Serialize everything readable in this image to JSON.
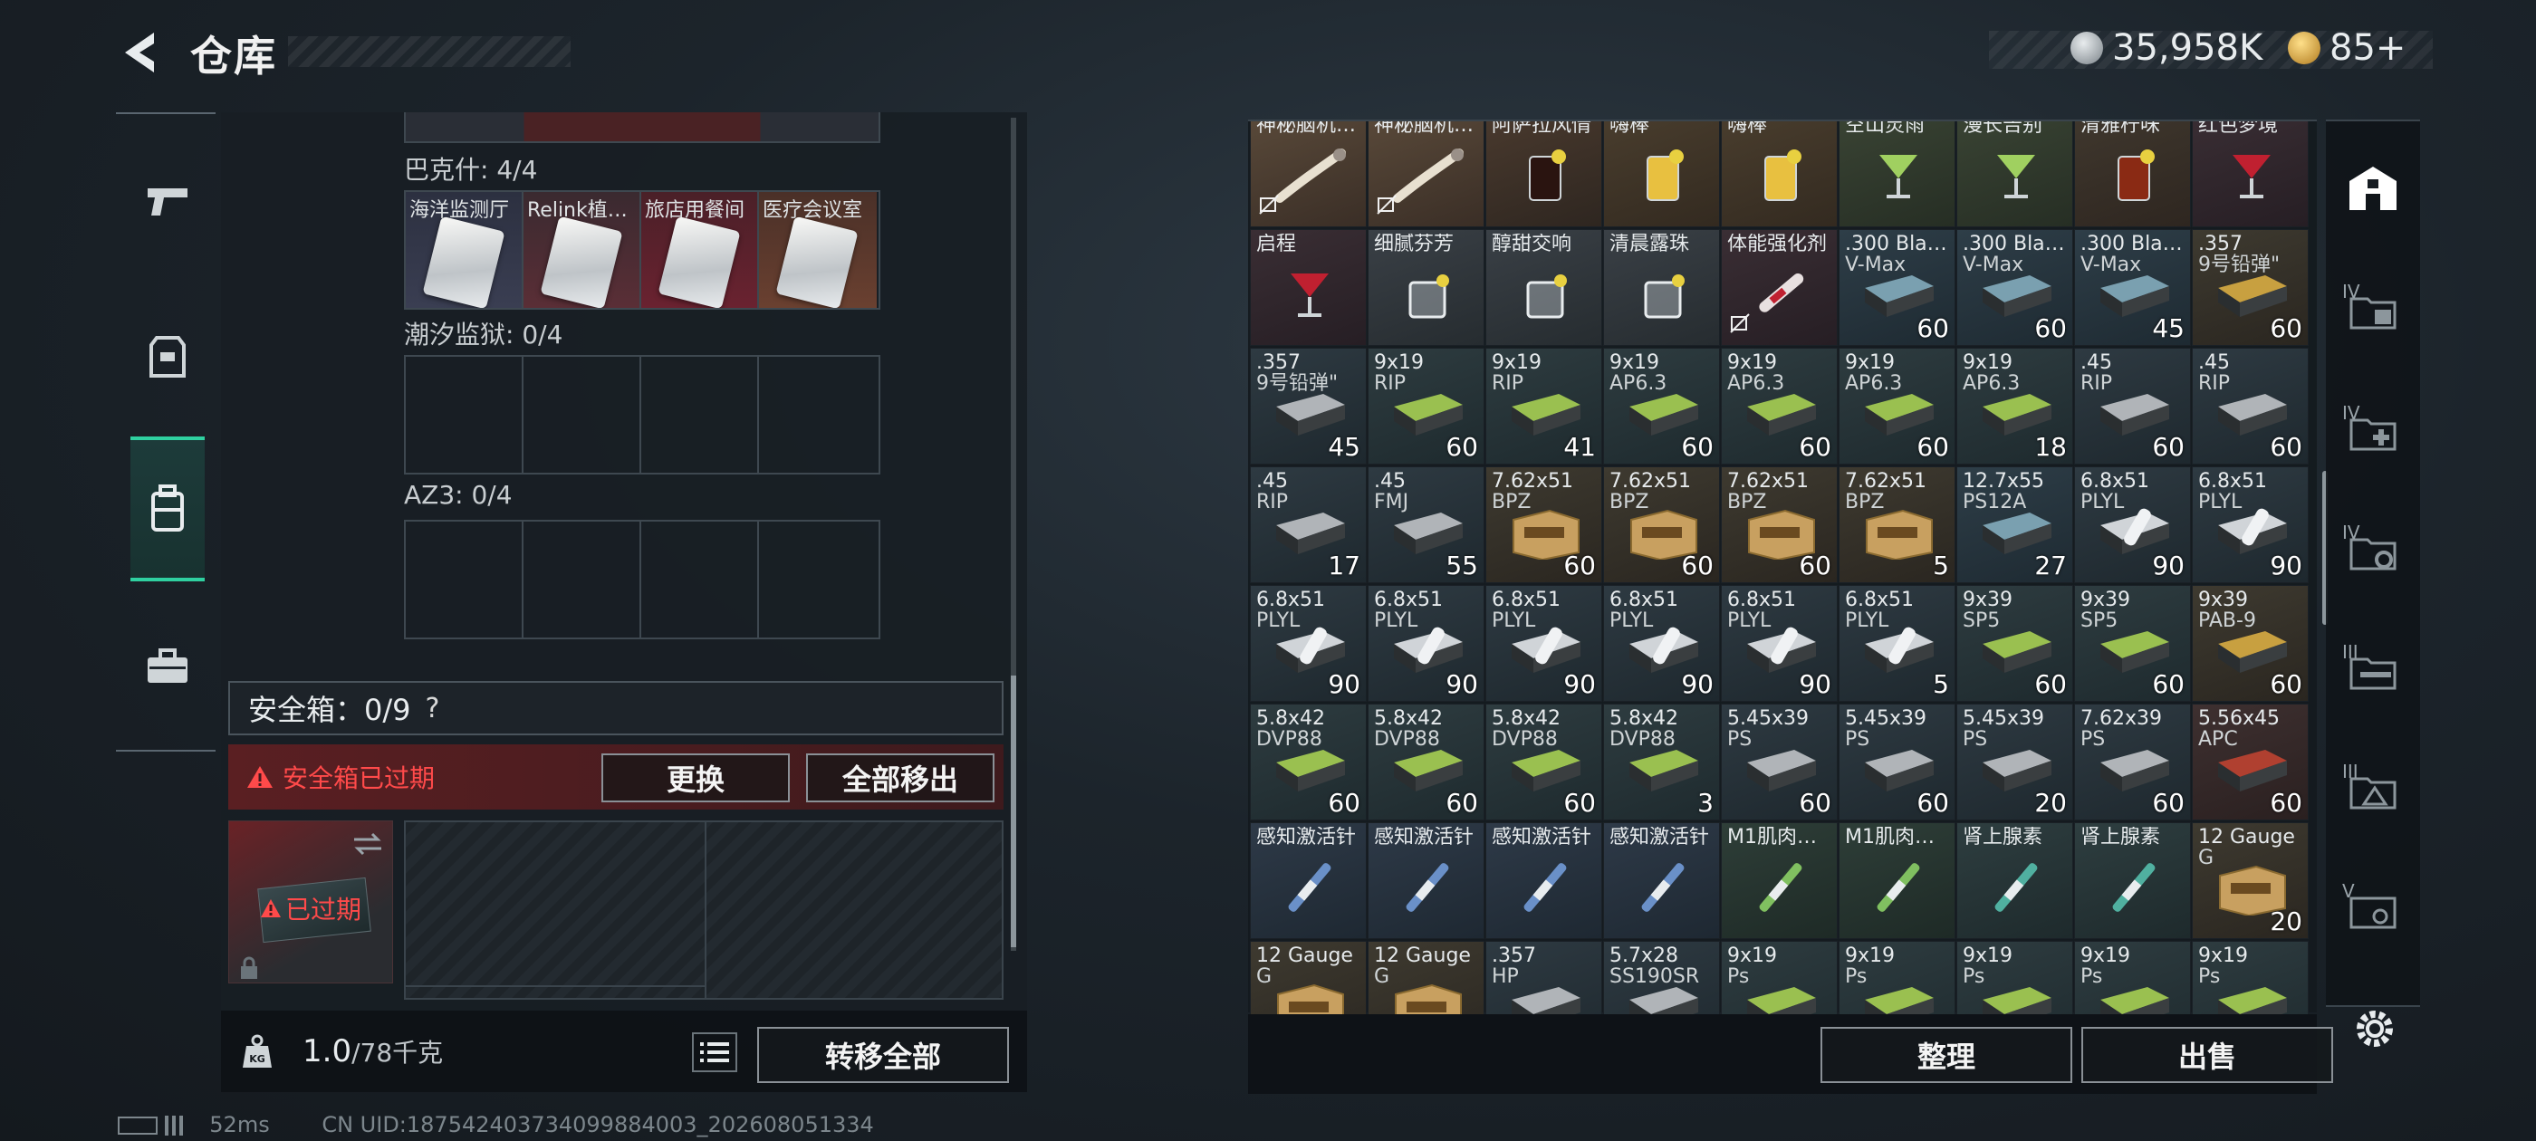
{
  "header": {
    "title": "仓库",
    "currency_silver": "35,958K",
    "currency_gold": "85+"
  },
  "left_nav": {
    "items": [
      {
        "name": "weapon",
        "icon": "pistol-icon"
      },
      {
        "name": "armor",
        "icon": "vest-icon"
      },
      {
        "name": "backpack",
        "icon": "backpack-icon",
        "active": true
      },
      {
        "name": "case",
        "icon": "briefcase-icon"
      }
    ]
  },
  "keycards": {
    "sections": [
      {
        "label": "巴克什: 4/4",
        "slots": [
          "海洋监测厅",
          "Relink植…",
          "旅店用餐间",
          "医疗会议室"
        ]
      },
      {
        "label": "潮汐监狱: 0/4",
        "slots": [
          "",
          "",
          "",
          ""
        ]
      },
      {
        "label": "AZ3: 0/4",
        "slots": [
          "",
          "",
          "",
          ""
        ]
      }
    ]
  },
  "safebox": {
    "label": "安全箱：0/9",
    "help": "?",
    "expired_label": "安全箱已过期",
    "replace_button": "更换",
    "move_all_button": "全部移出",
    "case_status": "已过期"
  },
  "bottom": {
    "weight_value": "1.0",
    "weight_unit": "/78千克",
    "transfer_all_button": "转移全部"
  },
  "status": {
    "ping": "52ms",
    "uid": "CN UID:187542403734099884003_202608051334"
  },
  "stash": {
    "sort_button": "整理",
    "sell_button": "出售",
    "rows": [
      [
        {
          "n1": "神秘脑机…",
          "n2": "",
          "c": "",
          "kind": "serum",
          "nodrop": true
        },
        {
          "n1": "神秘脑机…",
          "n2": "",
          "c": "",
          "kind": "serum",
          "nodrop": true
        },
        {
          "n1": "阿萨拉风情",
          "n2": "",
          "c": "",
          "kind": "drink-dark"
        },
        {
          "n1": "嗨棒",
          "n2": "",
          "c": "",
          "kind": "drink-yellow"
        },
        {
          "n1": "嗨棒",
          "n2": "",
          "c": "",
          "kind": "drink-yellow"
        },
        {
          "n1": "空山灵雨",
          "n2": "",
          "c": "",
          "kind": "drink-green"
        },
        {
          "n1": "漫长告别",
          "n2": "",
          "c": "",
          "kind": "drink-green"
        },
        {
          "n1": "清雅柠味",
          "n2": "",
          "c": "",
          "kind": "drink-tea"
        },
        {
          "n1": "红色梦境",
          "n2": "",
          "c": "",
          "kind": "drink-red"
        }
      ],
      [
        {
          "n1": "启程",
          "n2": "",
          "c": "",
          "kind": "drink-red"
        },
        {
          "n1": "细腻芬芳",
          "n2": "",
          "c": "",
          "kind": "glass"
        },
        {
          "n1": "醇甜交响",
          "n2": "",
          "c": "",
          "kind": "glass"
        },
        {
          "n1": "清晨露珠",
          "n2": "",
          "c": "",
          "kind": "glass"
        },
        {
          "n1": "体能强化剂",
          "n2": "",
          "c": "",
          "kind": "injector-red",
          "nodrop": true
        },
        {
          "n1": ".300 Bla…",
          "n2": "V-Max",
          "c": "60",
          "kind": "ammo-blue"
        },
        {
          "n1": ".300 Bla…",
          "n2": "V-Max",
          "c": "60",
          "kind": "ammo-blue"
        },
        {
          "n1": ".300 Bla…",
          "n2": "V-Max",
          "c": "45",
          "kind": "ammo-blue"
        },
        {
          "n1": ".357",
          "n2": "9号铅弹\"",
          "c": "60",
          "kind": "ammo-gold"
        }
      ],
      [
        {
          "n1": ".357",
          "n2": "9号铅弹\"",
          "c": "45",
          "kind": "ammo-grey"
        },
        {
          "n1": "9x19",
          "n2": "RIP",
          "c": "60",
          "kind": "ammo-green"
        },
        {
          "n1": "9x19",
          "n2": "RIP",
          "c": "41",
          "kind": "ammo-green"
        },
        {
          "n1": "9x19",
          "n2": "AP6.3",
          "c": "60",
          "kind": "ammo-green"
        },
        {
          "n1": "9x19",
          "n2": "AP6.3",
          "c": "60",
          "kind": "ammo-green"
        },
        {
          "n1": "9x19",
          "n2": "AP6.3",
          "c": "60",
          "kind": "ammo-green"
        },
        {
          "n1": "9x19",
          "n2": "AP6.3",
          "c": "18",
          "kind": "ammo-green"
        },
        {
          "n1": ".45",
          "n2": "RIP",
          "c": "60",
          "kind": "ammo-grey"
        },
        {
          "n1": ".45",
          "n2": "RIP",
          "c": "60",
          "kind": "ammo-grey"
        }
      ],
      [
        {
          "n1": ".45",
          "n2": "RIP",
          "c": "17",
          "kind": "ammo-grey"
        },
        {
          "n1": ".45",
          "n2": "FMJ",
          "c": "55",
          "kind": "ammo-grey"
        },
        {
          "n1": "7.62x51",
          "n2": "BPZ",
          "c": "60",
          "kind": "ammo-box"
        },
        {
          "n1": "7.62x51",
          "n2": "BPZ",
          "c": "60",
          "kind": "ammo-box"
        },
        {
          "n1": "7.62x51",
          "n2": "BPZ",
          "c": "60",
          "kind": "ammo-box"
        },
        {
          "n1": "7.62x51",
          "n2": "BPZ",
          "c": "5",
          "kind": "ammo-box"
        },
        {
          "n1": "12.7x55",
          "n2": "PS12A",
          "c": "27",
          "kind": "ammo-blue"
        },
        {
          "n1": "6.8x51",
          "n2": "PLYL",
          "c": "90",
          "kind": "ammo-white"
        },
        {
          "n1": "6.8x51",
          "n2": "PLYL",
          "c": "90",
          "kind": "ammo-white"
        }
      ],
      [
        {
          "n1": "6.8x51",
          "n2": "PLYL",
          "c": "90",
          "kind": "ammo-white"
        },
        {
          "n1": "6.8x51",
          "n2": "PLYL",
          "c": "90",
          "kind": "ammo-white"
        },
        {
          "n1": "6.8x51",
          "n2": "PLYL",
          "c": "90",
          "kind": "ammo-white"
        },
        {
          "n1": "6.8x51",
          "n2": "PLYL",
          "c": "90",
          "kind": "ammo-white"
        },
        {
          "n1": "6.8x51",
          "n2": "PLYL",
          "c": "90",
          "kind": "ammo-white"
        },
        {
          "n1": "6.8x51",
          "n2": "PLYL",
          "c": "5",
          "kind": "ammo-white"
        },
        {
          "n1": "9x39",
          "n2": "SP5",
          "c": "60",
          "kind": "ammo-green"
        },
        {
          "n1": "9x39",
          "n2": "SP5",
          "c": "60",
          "kind": "ammo-green"
        },
        {
          "n1": "9x39",
          "n2": "PAB-9",
          "c": "60",
          "kind": "ammo-gold"
        }
      ],
      [
        {
          "n1": "5.8x42",
          "n2": "DVP88",
          "c": "60",
          "kind": "ammo-green"
        },
        {
          "n1": "5.8x42",
          "n2": "DVP88",
          "c": "60",
          "kind": "ammo-green"
        },
        {
          "n1": "5.8x42",
          "n2": "DVP88",
          "c": "60",
          "kind": "ammo-green"
        },
        {
          "n1": "5.8x42",
          "n2": "DVP88",
          "c": "3",
          "kind": "ammo-green"
        },
        {
          "n1": "5.45x39",
          "n2": "PS",
          "c": "60",
          "kind": "ammo-grey"
        },
        {
          "n1": "5.45x39",
          "n2": "PS",
          "c": "60",
          "kind": "ammo-grey"
        },
        {
          "n1": "5.45x39",
          "n2": "PS",
          "c": "20",
          "kind": "ammo-grey"
        },
        {
          "n1": "7.62x39",
          "n2": "PS",
          "c": "60",
          "kind": "ammo-grey"
        },
        {
          "n1": "5.56x45",
          "n2": "APC",
          "c": "60",
          "kind": "ammo-red"
        }
      ],
      [
        {
          "n1": "感知激活针",
          "n2": "",
          "c": "",
          "kind": "syringe-blue"
        },
        {
          "n1": "感知激活针",
          "n2": "",
          "c": "",
          "kind": "syringe-blue"
        },
        {
          "n1": "感知激活针",
          "n2": "",
          "c": "",
          "kind": "syringe-blue"
        },
        {
          "n1": "感知激活针",
          "n2": "",
          "c": "",
          "kind": "syringe-blue"
        },
        {
          "n1": "M1肌肉…",
          "n2": "",
          "c": "",
          "kind": "syringe-green"
        },
        {
          "n1": "M1肌肉…",
          "n2": "",
          "c": "",
          "kind": "syringe-green"
        },
        {
          "n1": "肾上腺素",
          "n2": "",
          "c": "",
          "kind": "syringe-teal"
        },
        {
          "n1": "肾上腺素",
          "n2": "",
          "c": "",
          "kind": "syringe-teal"
        },
        {
          "n1": "12 Gauge",
          "n2": "G",
          "c": "20",
          "kind": "ammo-box"
        }
      ],
      [
        {
          "n1": "12 Gauge",
          "n2": "G",
          "c": "",
          "kind": "ammo-box"
        },
        {
          "n1": "12 Gauge",
          "n2": "G",
          "c": "",
          "kind": "ammo-box"
        },
        {
          "n1": ".357",
          "n2": "HP",
          "c": "",
          "kind": "ammo-grey"
        },
        {
          "n1": "5.7x28",
          "n2": "SS190SR",
          "c": "",
          "kind": "ammo-grey"
        },
        {
          "n1": "9x19",
          "n2": "Ps",
          "c": "",
          "kind": "ammo-green"
        },
        {
          "n1": "9x19",
          "n2": "Ps",
          "c": "",
          "kind": "ammo-green"
        },
        {
          "n1": "9x19",
          "n2": "Ps",
          "c": "",
          "kind": "ammo-green"
        },
        {
          "n1": "9x19",
          "n2": "Ps",
          "c": "",
          "kind": "ammo-green"
        },
        {
          "n1": "9x19",
          "n2": "Ps",
          "c": "",
          "kind": "ammo-green"
        }
      ]
    ]
  },
  "right_nav": {
    "items": [
      {
        "icon": "home-icon",
        "label": ""
      },
      {
        "icon": "folder-stack-icon",
        "label": "IV"
      },
      {
        "icon": "medical-folder-icon",
        "label": "IV"
      },
      {
        "icon": "gear-folder-icon",
        "label": "IV"
      },
      {
        "icon": "rifle-folder-icon",
        "label": "III"
      },
      {
        "icon": "warning-folder-icon",
        "label": "III"
      },
      {
        "icon": "stack-box-icon",
        "label": "V"
      },
      {
        "icon": "settings-icon",
        "label": ""
      }
    ]
  }
}
